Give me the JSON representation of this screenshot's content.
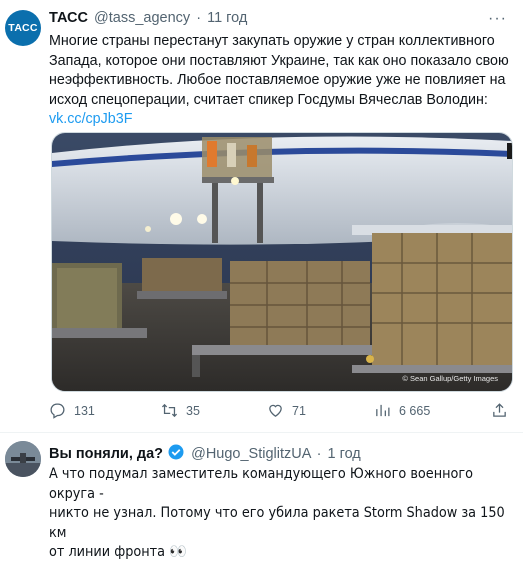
{
  "tweet1": {
    "avatar_text": "ТАСС",
    "name": "ТАСС",
    "handle": "@tass_agency",
    "separator": "·",
    "time": "11 год",
    "more": "···",
    "text_lines": [
      "Многие страны перестанут закупать оружие у стран коллективного",
      "Запада, которое они поставляют Украине, так как оно показало свою",
      "неэффективность. Любое поставляемое оружие уже не повлияет на",
      "исход спецоперации, считает спикер Госдумы Вячеслав Володин:"
    ],
    "link": "vk.cc/cpJb3F",
    "image_credit": "© Sean Gallup/Getty Images",
    "actions": {
      "replies": "131",
      "retweets": "35",
      "likes": "71",
      "views": "6 665"
    }
  },
  "tweet2": {
    "name": "Вы поняли, да?",
    "handle": "@Hugo_StiglitzUA",
    "separator": "·",
    "time": "1 год",
    "text_lines": [
      "А что подумал заместитель командующего Южного военного округа -",
      "никто не узнал. Потому что его убила ракета Storm Shadow за 150 км",
      "от линии фронта 👀"
    ]
  },
  "colors": {
    "accent": "#1d9bf0",
    "muted": "#536471",
    "tass_blue": "#0b6fad"
  }
}
